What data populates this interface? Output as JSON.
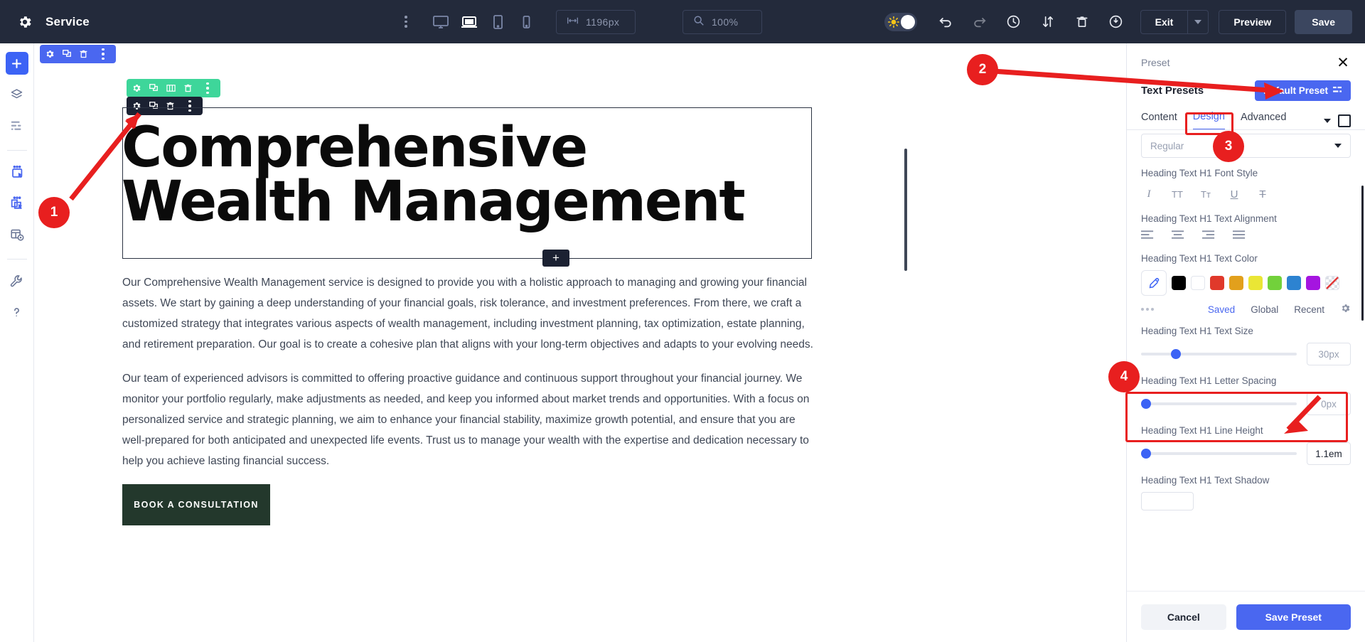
{
  "topbar": {
    "gear_icon": "gear-icon",
    "title": "Service",
    "kebab_icon": "more-vertical-icon",
    "devices": [
      {
        "name": "desktop-view",
        "icon": "monitor-icon",
        "active": false
      },
      {
        "name": "laptop-view",
        "icon": "laptop-icon",
        "active": true
      },
      {
        "name": "tablet-view",
        "icon": "tablet-icon",
        "active": false
      },
      {
        "name": "mobile-view",
        "icon": "mobile-icon",
        "active": false
      }
    ],
    "width_field": {
      "icon": "width-arrows-icon",
      "value": "1196px"
    },
    "zoom_field": {
      "icon": "magnifier-icon",
      "value": "100%"
    },
    "theme_toggle": {
      "icon": "sun-icon",
      "state": "light"
    },
    "icons": [
      {
        "name": "undo-icon"
      },
      {
        "name": "redo-icon"
      },
      {
        "name": "history-icon"
      },
      {
        "name": "sort-transfer-icon"
      },
      {
        "name": "trash-icon"
      },
      {
        "name": "power-icon"
      }
    ],
    "exit_label": "Exit",
    "exit_caret_icon": "chevron-down-icon",
    "preview_label": "Preview",
    "save_label": "Save"
  },
  "rail": {
    "items": [
      {
        "name": "add-element",
        "icon": "plus-icon",
        "primary": true
      },
      {
        "name": "layers",
        "icon": "layers-icon"
      },
      {
        "name": "navigator",
        "icon": "list-icon"
      },
      {
        "name": "global-blocks",
        "icon": "block-select-icon"
      },
      {
        "name": "saved-blocks",
        "icon": "blocks-copy-select-icon"
      },
      {
        "name": "page-settings",
        "icon": "page-gear-icon"
      },
      {
        "name": "tools",
        "icon": "wrench-icon"
      },
      {
        "name": "help",
        "icon": "question-icon"
      }
    ]
  },
  "canvas": {
    "section_toolbar_blue": [
      "gear-icon",
      "duplicate-icon",
      "trash-icon",
      "more-vertical-icon"
    ],
    "section_toolbar_green": [
      "gear-icon",
      "duplicate-icon",
      "columns-icon",
      "trash-icon",
      "more-vertical-icon"
    ],
    "section_toolbar_dark": [
      "gear-icon",
      "duplicate-icon",
      "trash-icon",
      "more-vertical-icon"
    ],
    "heading": "Comprehensive Wealth Management",
    "add_tab_icon": "plus-icon",
    "paragraphs": [
      "Our Comprehensive Wealth Management service is designed to provide you with a holistic approach to managing and growing your financial assets. We start by gaining a deep understanding of your financial goals, risk tolerance, and investment preferences. From there, we craft a customized strategy that integrates various aspects of wealth management, including investment planning, tax optimization, estate planning, and retirement preparation. Our goal is to create a cohesive plan that aligns with your long-term objectives and adapts to your evolving needs.",
      "Our team of experienced advisors is committed to offering proactive guidance and continuous support throughout your financial journey. We monitor your portfolio regularly, make adjustments as needed, and keep you informed about market trends and opportunities. With a focus on personalized service and strategic planning, we aim to enhance your financial stability, maximize growth potential, and ensure that you are well-prepared for both anticipated and unexpected life events. Trust us to manage your wealth with the expertise and dedication necessary to help you achieve lasting financial success."
    ],
    "cta_label": "BOOK A CONSULTATION"
  },
  "panel": {
    "title": "Preset",
    "close_icon": "close-icon",
    "text_presets_label": "Text Presets",
    "default_preset_label": "Default Preset",
    "default_preset_icon": "preset-swap-icon",
    "tabs": [
      {
        "label": "Content",
        "active": false
      },
      {
        "label": "Design",
        "active": true
      },
      {
        "label": "Advanced",
        "active": false
      }
    ],
    "tab_caret_icon": "chevron-down-icon",
    "tab_box_icon": "square-icon",
    "font_weight_value": "Regular",
    "font_weight_caret_icon": "chevron-down-icon",
    "font_style_label": "Heading Text H1 Font Style",
    "font_style_icons": [
      {
        "name": "italic-icon",
        "glyph": "I"
      },
      {
        "name": "uppercase-icon",
        "glyph": "TT"
      },
      {
        "name": "capitalize-icon",
        "glyph": "Tт"
      },
      {
        "name": "underline-icon",
        "glyph": "U"
      },
      {
        "name": "strikethrough-icon",
        "glyph": "T"
      }
    ],
    "alignment_label": "Heading Text H1 Text Alignment",
    "alignment_icons": [
      "align-left-icon",
      "align-center-icon",
      "align-right-icon",
      "align-justify-icon"
    ],
    "color_label": "Heading Text H1 Text Color",
    "color_picker_icon": "eyedropper-icon",
    "swatches": [
      "#000000",
      "#ffffff",
      "#e0392b",
      "#e2a01c",
      "#eae635",
      "#72d13b",
      "#2d83d1",
      "#a515e0",
      "none"
    ],
    "color_meta": [
      {
        "label": "Saved",
        "active": true
      },
      {
        "label": "Global",
        "active": false
      },
      {
        "label": "Recent",
        "active": false
      }
    ],
    "color_meta_gear_icon": "gear-icon",
    "text_size_label": "Heading Text H1 Text Size",
    "text_size_value": "30px",
    "text_size_percent": 19,
    "letter_spacing_label": "Heading Text H1 Letter Spacing",
    "letter_spacing_value": "0px",
    "letter_spacing_percent": 1,
    "line_height_label": "Heading Text H1 Line Height",
    "line_height_value": "1.1em",
    "line_height_percent": 1,
    "text_shadow_label": "Heading Text H1 Text Shadow",
    "cancel_label": "Cancel",
    "save_preset_label": "Save Preset"
  },
  "annotations": {
    "markers": [
      {
        "label": "1",
        "target": "heading-element-toolbar"
      },
      {
        "label": "2",
        "target": "default-preset-button"
      },
      {
        "label": "3",
        "target": "design-tab"
      },
      {
        "label": "4",
        "target": "text-size-field"
      }
    ],
    "color": "#e81f1f"
  }
}
